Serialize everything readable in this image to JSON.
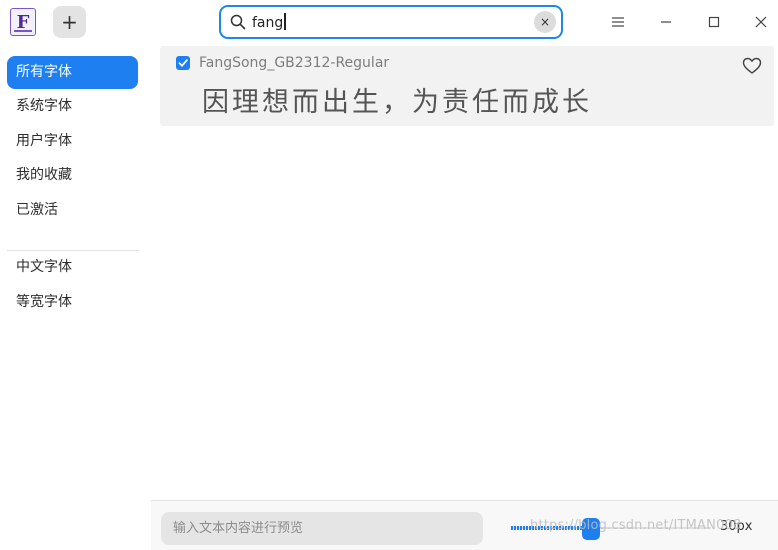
{
  "titlebar": {
    "app_icon_glyph": "F",
    "app_icon_name": "font-manager-app-icon",
    "add_label": "+",
    "search": {
      "value": "fang",
      "clear_label": "×"
    },
    "window_controls": [
      "menu-icon",
      "minimize-icon",
      "maximize-icon",
      "close-icon"
    ]
  },
  "sidebar": {
    "items": [
      {
        "label": "所有字体",
        "active": true
      },
      {
        "label": "系统字体",
        "active": false
      },
      {
        "label": "用户字体",
        "active": false
      },
      {
        "label": "我的收藏",
        "active": false
      },
      {
        "label": "已激活",
        "active": false
      }
    ],
    "group2": [
      {
        "label": "中文字体",
        "active": false
      },
      {
        "label": "等宽字体",
        "active": false
      }
    ]
  },
  "fonts": [
    {
      "name": "FangSong_GB2312-Regular",
      "checked": true,
      "favorite": false,
      "preview_text": "因理想而出生，为责任而成长"
    }
  ],
  "bottombar": {
    "preview_placeholder": "输入文本内容进行预览",
    "size_label": "30px",
    "size_slider_fraction": 0.4
  },
  "watermark": "https://blog.csdn.net/ITMAN008",
  "colors": {
    "accent": "#1e7ff0",
    "row_bg": "#f2f2f2"
  }
}
